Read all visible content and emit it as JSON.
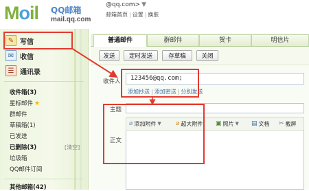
{
  "header": {
    "logo_text_m": "M",
    "logo_text_o": "o",
    "logo_text_il": "il",
    "logo_cn": "QQ邮箱",
    "logo_domain": "mail.qq.com",
    "account": "@qq.com>",
    "account_caret": "▼",
    "links": [
      "邮箱首页",
      "设置",
      "换肤"
    ],
    "link_sep": "|"
  },
  "sidebar": {
    "compose_label": "写信",
    "inbox_label": "收信",
    "contacts_label": "通讯录",
    "folders": [
      {
        "label": "收件箱(3)",
        "bold": true
      },
      {
        "label": "星标邮件",
        "star": "★"
      },
      {
        "label": "群邮件"
      },
      {
        "label": "草稿箱(1)"
      },
      {
        "label": "已发送"
      },
      {
        "label": "已删除(3)",
        "bold": true
      },
      {
        "label": "垃圾箱"
      },
      {
        "label": "QQ邮件订阅"
      }
    ],
    "clear_label": "[清空]",
    "other_box_label": "其他邮箱(42)"
  },
  "tabs": [
    {
      "label": "普通邮件",
      "active": true
    },
    {
      "label": "群邮件"
    },
    {
      "label": "贺卡"
    },
    {
      "label": "明信片"
    }
  ],
  "toolbar": {
    "buttons": [
      "发送",
      "定时发送",
      "存草稿",
      "关闭"
    ]
  },
  "compose": {
    "to_label": "收件人",
    "to_value": "123456@qq.com;",
    "add_cc": "添加抄送",
    "add_bcc": "添加密送",
    "separate_send": "分别发送",
    "link_sep": "|",
    "subject_label": "主题",
    "body_label": "正文",
    "editor_buttons": [
      {
        "label": "添加附件",
        "icon": "paperclip-icon",
        "dropdown": true
      },
      {
        "label": "超大附件",
        "icon": "large-attachment-icon"
      },
      {
        "label": "照片",
        "icon": "photo-icon",
        "dropdown": true
      },
      {
        "label": "文档",
        "icon": "document-icon"
      },
      {
        "label": "截屏",
        "icon": "screenshot-icon"
      }
    ],
    "dropdown_glyph": "▼"
  },
  "colors": {
    "annotation_red": "#e23a30",
    "brand_green": "#7fb13c",
    "brand_blue": "#4ea0d8"
  }
}
